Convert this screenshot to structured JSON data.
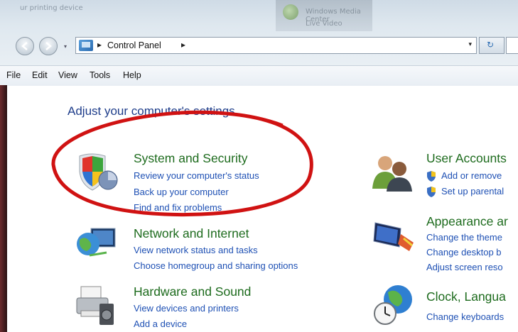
{
  "window": {
    "background_caption": "ur printing device",
    "taskbar_preview": "Windows Media Center",
    "taskbar_preview_sub": "Live Video"
  },
  "address_bar": {
    "breadcrumb": "Control Panel",
    "separator": "▸",
    "dropdown": "▾",
    "refresh": "↻"
  },
  "menu": [
    "File",
    "Edit",
    "View",
    "Tools",
    "Help"
  ],
  "heading": "Adjust your computer's settings",
  "categories": [
    {
      "title": "System and Security",
      "icon": "shield-icon",
      "links": [
        "Review your computer's status",
        "Back up your computer",
        "Find and fix problems"
      ]
    },
    {
      "title": "Network and Internet",
      "icon": "network-globe-icon",
      "links": [
        "View network status and tasks",
        "Choose homegroup and sharing options"
      ]
    },
    {
      "title": "Hardware and Sound",
      "icon": "printer-speaker-icon",
      "links": [
        "View devices and printers",
        "Add a device"
      ]
    },
    {
      "title": "User Accounts",
      "icon": "users-icon",
      "links": [
        "Add or remove",
        "Set up parental"
      ]
    },
    {
      "title": "Appearance ar",
      "icon": "display-paint-icon",
      "links": [
        "Change the theme",
        "Change desktop b",
        "Adjust screen reso"
      ]
    },
    {
      "title": "Clock, Langua",
      "icon": "clock-globe-icon",
      "links": [
        "Change keyboards"
      ]
    }
  ],
  "annotation_color": "#d01212"
}
